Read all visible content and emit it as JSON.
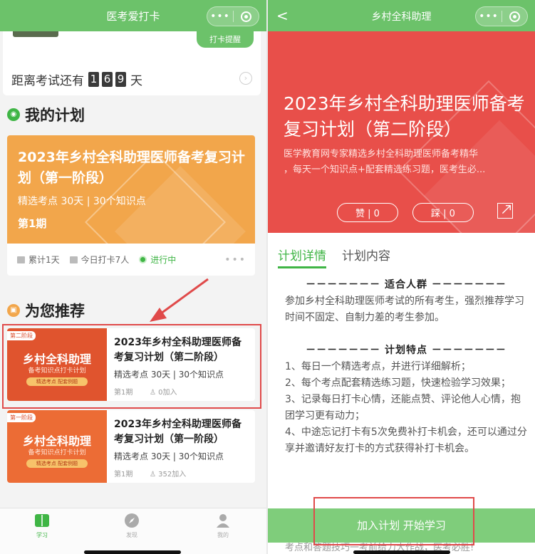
{
  "left": {
    "header": {
      "title": "医考爱打卡",
      "dots": "•••"
    },
    "remind_button": "打卡提醒",
    "countdown": {
      "prefix": "距离考试还有",
      "digits": [
        "1",
        "6",
        "9"
      ],
      "suffix": "天"
    },
    "my_plan": {
      "section_title": "我的计划",
      "title": "2023年乡村全科助理医师备考复习计划（第一阶段）",
      "sub": "精选考点  30天 | 30个知识点",
      "period": "第1期",
      "stats": [
        "累计1天",
        "今日打卡7人"
      ],
      "status": "进行中",
      "more": "•••"
    },
    "recommend": {
      "section_title": "为您推荐",
      "items": [
        {
          "tag": "第二阶段",
          "thumb_big": "乡村全科助理",
          "thumb_small": "备考知识点打卡计划",
          "thumb_pill": "精选考点  配套例题",
          "title": "2023年乡村全科助理医师备考复习计划（第二阶段）",
          "sub": "精选考点  30天 | 30个知识点",
          "period": "第1期",
          "joined": "0加入"
        },
        {
          "tag": "第一阶段",
          "thumb_big": "乡村全科助理",
          "thumb_small": "备考知识点打卡计划",
          "thumb_pill": "精选考点  配套例题",
          "title": "2023年乡村全科助理医师备考复习计划（第一阶段）",
          "sub": "精选考点  30天 | 30个知识点",
          "period": "第1期",
          "joined": "352加入"
        }
      ]
    },
    "tabbar": {
      "study": "学习",
      "discover": "发现",
      "mine": "我的"
    }
  },
  "right": {
    "header": {
      "back": "<",
      "title": "乡村全科助理",
      "dots": "•••"
    },
    "hero": {
      "title": "2023年乡村全科助理医师备考复习计划（第二阶段）",
      "desc1": "医学教育网专家精选乡村全科助理医师备考精华",
      "desc2": "，每天一个知识点+配套精选练习题，医考生必...",
      "like": "赞 | 0",
      "dislike": "踩 | 0"
    },
    "tabs": [
      "计划详情",
      "计划内容"
    ],
    "audience": {
      "heading": "－－－－－－－  适合人群  －－－－－－－",
      "text": "参加乡村全科助理医师考试的所有考生，强烈推荐学习时间不固定、自制力差的考生参加。"
    },
    "features": {
      "heading": "－－－－－－－  计划特点  －－－－－－－",
      "lines": [
        "1、每日一个精选考点，并进行详细解析；",
        "2、每个考点配套精选练习题，快速检验学习效果；",
        "3、记录每日打卡心情，还能点赞、评论他人心情，抱团学习更有动力；",
        "4、中途忘记打卡有5次免费补打卡机会，还可以通过分享并邀请好友打卡的方式获得补打卡机会。"
      ]
    },
    "cta": "加入计划 开始学习",
    "footer_text": "考点和答题技巧一考前给力大作战，医考必胜!"
  },
  "colors": {
    "green": "#6cc26a",
    "orange": "#f2a64b",
    "red": "#e84f4a",
    "highlight": "#e04a4a"
  }
}
